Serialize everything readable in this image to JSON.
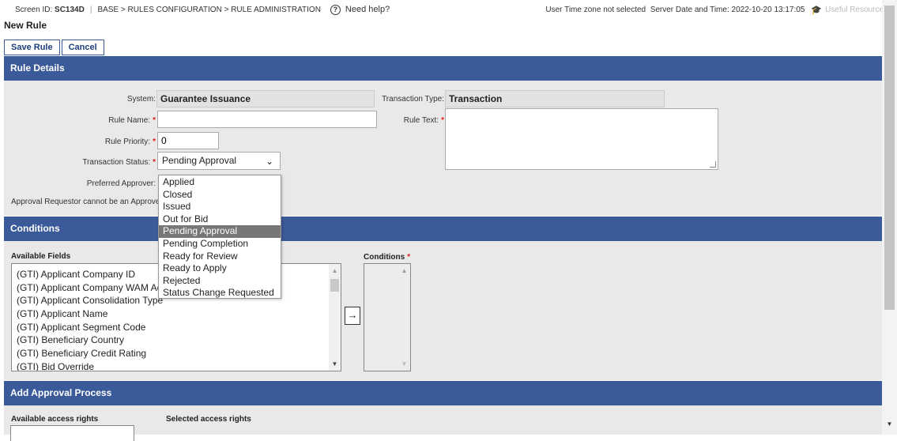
{
  "header": {
    "screen_id_label": "Screen ID:",
    "screen_id": "SC134D",
    "breadcrumb": "BASE > RULES CONFIGURATION > RULE ADMINISTRATION",
    "help_label": "Need help?",
    "timezone_text": "User Time zone not selected",
    "server_time_label": "Server Date and Time:",
    "server_time": "2022-10-20 13:17:05",
    "useful_resources": "Useful Resources"
  },
  "page_title": "New Rule",
  "toolbar": {
    "save_label": "Save Rule",
    "cancel_label": "Cancel"
  },
  "rule_details": {
    "section_title": "Rule Details",
    "system_label": "System:",
    "system_value": "Guarantee Issuance",
    "transaction_type_label": "Transaction Type:",
    "transaction_type_value": "Transaction",
    "rule_name_label": "Rule Name:",
    "rule_name_value": "",
    "rule_text_label": "Rule Text:",
    "rule_priority_label": "Rule Priority:",
    "rule_priority_value": "0",
    "transaction_status_label": "Transaction Status:",
    "transaction_status_value": "Pending Approval",
    "preferred_approver_label": "Preferred Approver:",
    "approval_note": "Approval Requestor cannot be an Approver"
  },
  "status_dropdown": {
    "options": [
      "Applied",
      "Closed",
      "Issued",
      "Out for Bid",
      "Pending Approval",
      "Pending Completion",
      "Ready for Review",
      "Ready to Apply",
      "Rejected",
      "Status Change Requested"
    ],
    "highlighted": "Pending Approval"
  },
  "conditions": {
    "section_title": "Conditions",
    "available_fields_label": "Available Fields",
    "conditions_label": "Conditions",
    "move_arrow": "→",
    "available_fields": [
      "(GTI) Applicant Company ID",
      "(GTI) Applicant Company WAM Activ",
      "(GTI) Applicant Consolidation Type",
      "(GTI) Applicant Name",
      "(GTI) Applicant Segment Code",
      "(GTI) Beneficiary Country",
      "(GTI) Beneficiary Credit Rating",
      "(GTI) Bid Override"
    ]
  },
  "approval": {
    "section_title": "Add Approval Process",
    "available_rights_label": "Available access rights",
    "selected_rights_label": "Selected access rights"
  },
  "colors": {
    "section_header": "#3b5a9a",
    "required": "#e01b1b",
    "body_bg": "#e9e9e9"
  }
}
